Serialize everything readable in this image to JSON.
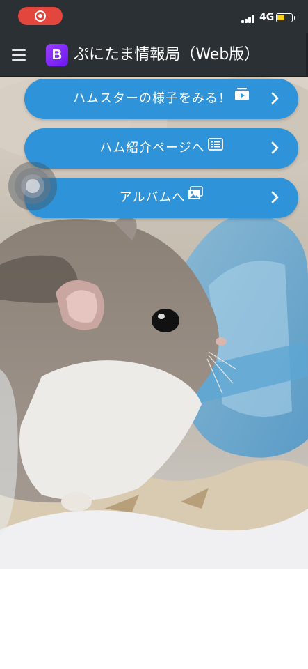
{
  "status_bar": {
    "network": "4G",
    "battery_level": 0.5,
    "colors": {
      "record": "#e2463c",
      "battery": "#f6d21e"
    }
  },
  "navbar": {
    "brand_logo": "B",
    "title": "ぷにたま情報局（Web版）",
    "colors": {
      "background": "#2b3035",
      "logo": "#7b2af7"
    }
  },
  "menu": {
    "items": [
      {
        "label": "ハムスターの様子をみる！",
        "icon": "video-play-icon"
      },
      {
        "label": "ハム紹介ページへ",
        "icon": "list-card-icon"
      },
      {
        "label": "アルバムへ",
        "icon": "photo-icon"
      }
    ],
    "colors": {
      "button": "#2e93d8",
      "text": "#ffffff"
    }
  }
}
